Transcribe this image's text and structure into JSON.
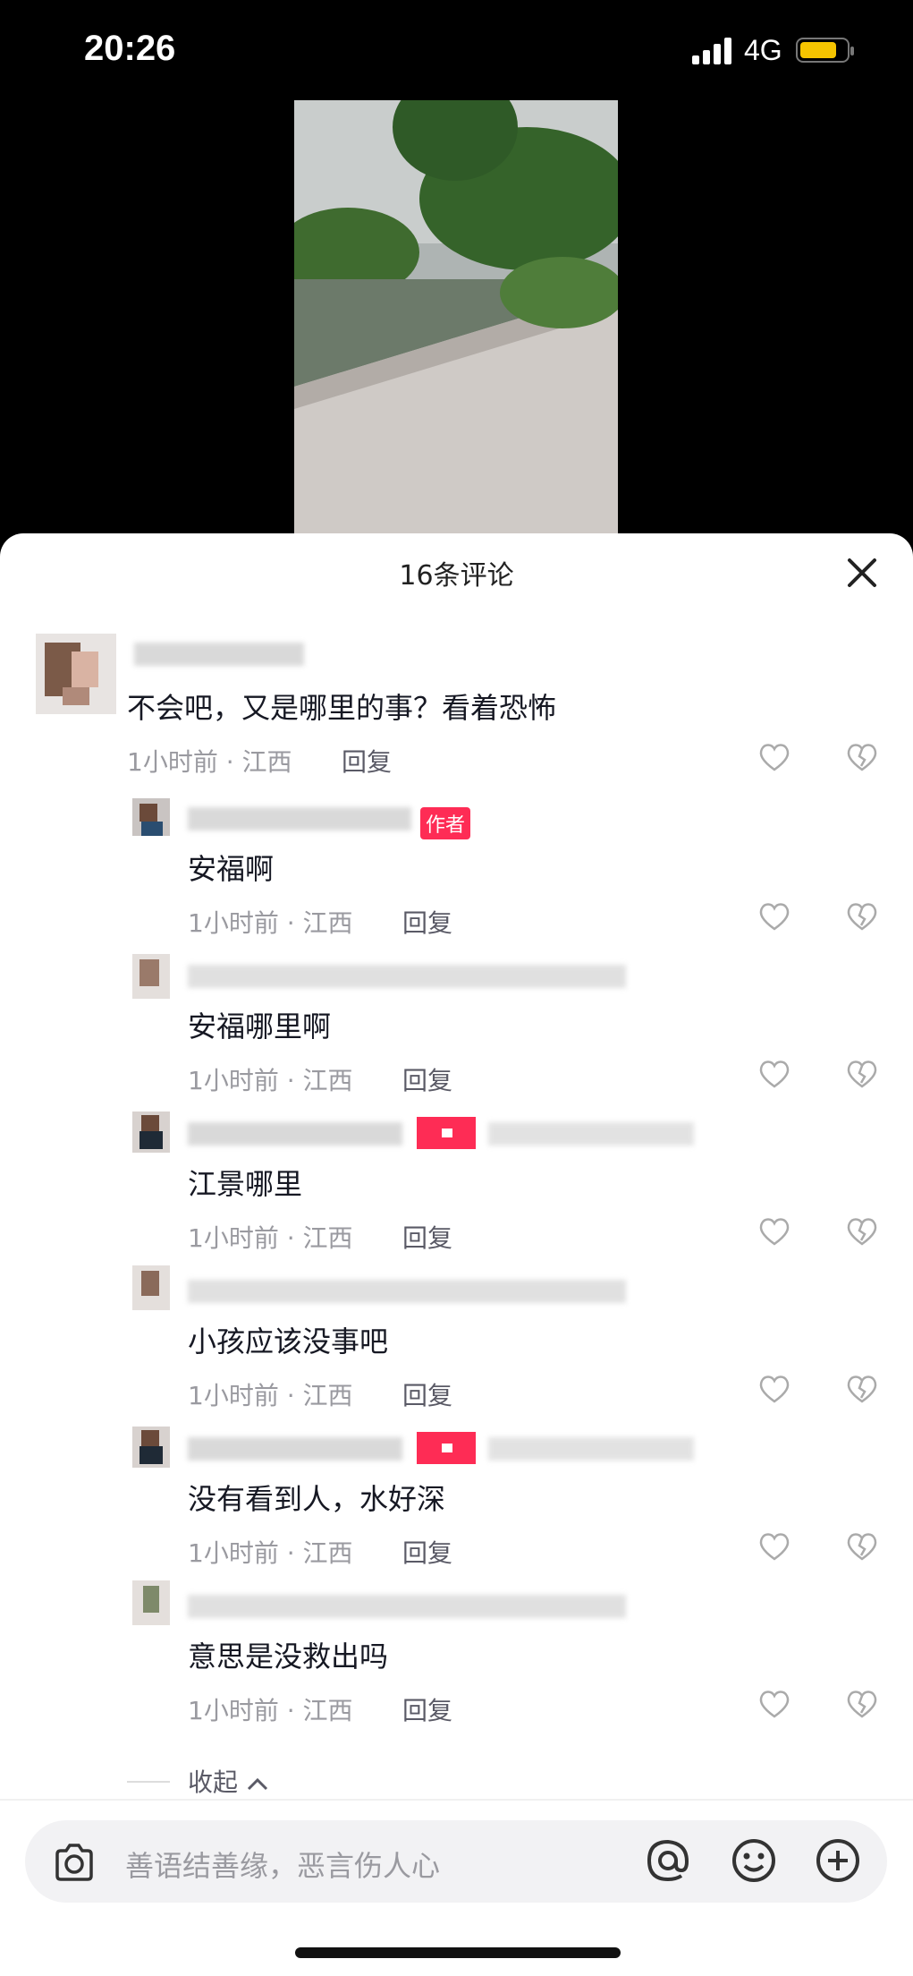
{
  "status": {
    "time": "20:26",
    "network": "4G"
  },
  "sheet": {
    "title": "16条评论"
  },
  "comments": [
    {
      "text": "不会吧，又是哪里的事？看着恐怖",
      "meta": "1小时前 · 江西",
      "reply": "回复"
    },
    {
      "text": "安福啊",
      "meta": "1小时前 · 江西",
      "reply": "回复",
      "badge": "作者"
    },
    {
      "text": "安福哪里啊",
      "meta": "1小时前 · 江西",
      "reply": "回复"
    },
    {
      "text": "江景哪里",
      "meta": "1小时前 · 江西",
      "reply": "回复"
    },
    {
      "text": "小孩应该没事吧",
      "meta": "1小时前 · 江西",
      "reply": "回复"
    },
    {
      "text": "没有看到人，水好深",
      "meta": "1小时前 · 江西",
      "reply": "回复"
    },
    {
      "text": "意思是没救出吗",
      "meta": "1小时前 · 江西",
      "reply": "回复"
    }
  ],
  "collapse_label": "收起",
  "input": {
    "placeholder": "善语结善缘，恶言伤人心"
  },
  "colors": {
    "accent": "#fe2c55",
    "battery": "#f5c400"
  }
}
